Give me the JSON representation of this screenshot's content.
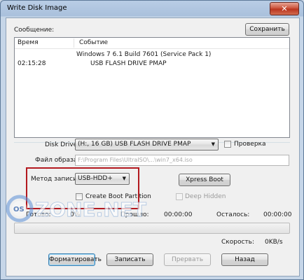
{
  "window": {
    "title": "Write Disk Image",
    "close_glyph": "✕"
  },
  "log": {
    "section_label": "Сообщение:",
    "save_button": "Сохранить",
    "col_time": "Время",
    "col_event": "Событие",
    "rows": [
      {
        "time": "",
        "event": "Windows 7 6.1 Build 7601 (Service Pack 1)"
      },
      {
        "time": "02:15:28",
        "event": "USB FLASH DRIVE PMAP"
      }
    ]
  },
  "disk": {
    "label": "Disk Drive:",
    "value": "(H:, 16 GB)       USB FLASH DRIVE PMAP",
    "verify_label": "Проверка"
  },
  "image": {
    "label": "Файл образа:",
    "value": "F:\\Program Files\\UltraISO\\...\\win7_x64.iso"
  },
  "method": {
    "label": "Метод записи:",
    "value": "USB-HDD+",
    "create_boot_label": "Create Boot Partition"
  },
  "xpress_boot": "Xpress Boot",
  "deep_hidden": "Deep Hidden",
  "status": {
    "done_label": "Готово:",
    "done_value": "0%",
    "elapsed_label": "Прошло:",
    "elapsed_value": "00:00:00",
    "remaining_label": "Осталось:",
    "remaining_value": "00:00:00",
    "speed_label": "Скорость:",
    "speed_value": "0KB/s",
    "progress": 0
  },
  "buttons": {
    "format": "Форматировать",
    "write": "Записать",
    "abort": "Прервать",
    "back": "Назад"
  },
  "watermark": {
    "brand_os": "OS",
    "brand_text": "ZONE.NET"
  },
  "colors": {
    "highlight_box": "#b3191f",
    "titlebar": "#a9c0dc"
  }
}
